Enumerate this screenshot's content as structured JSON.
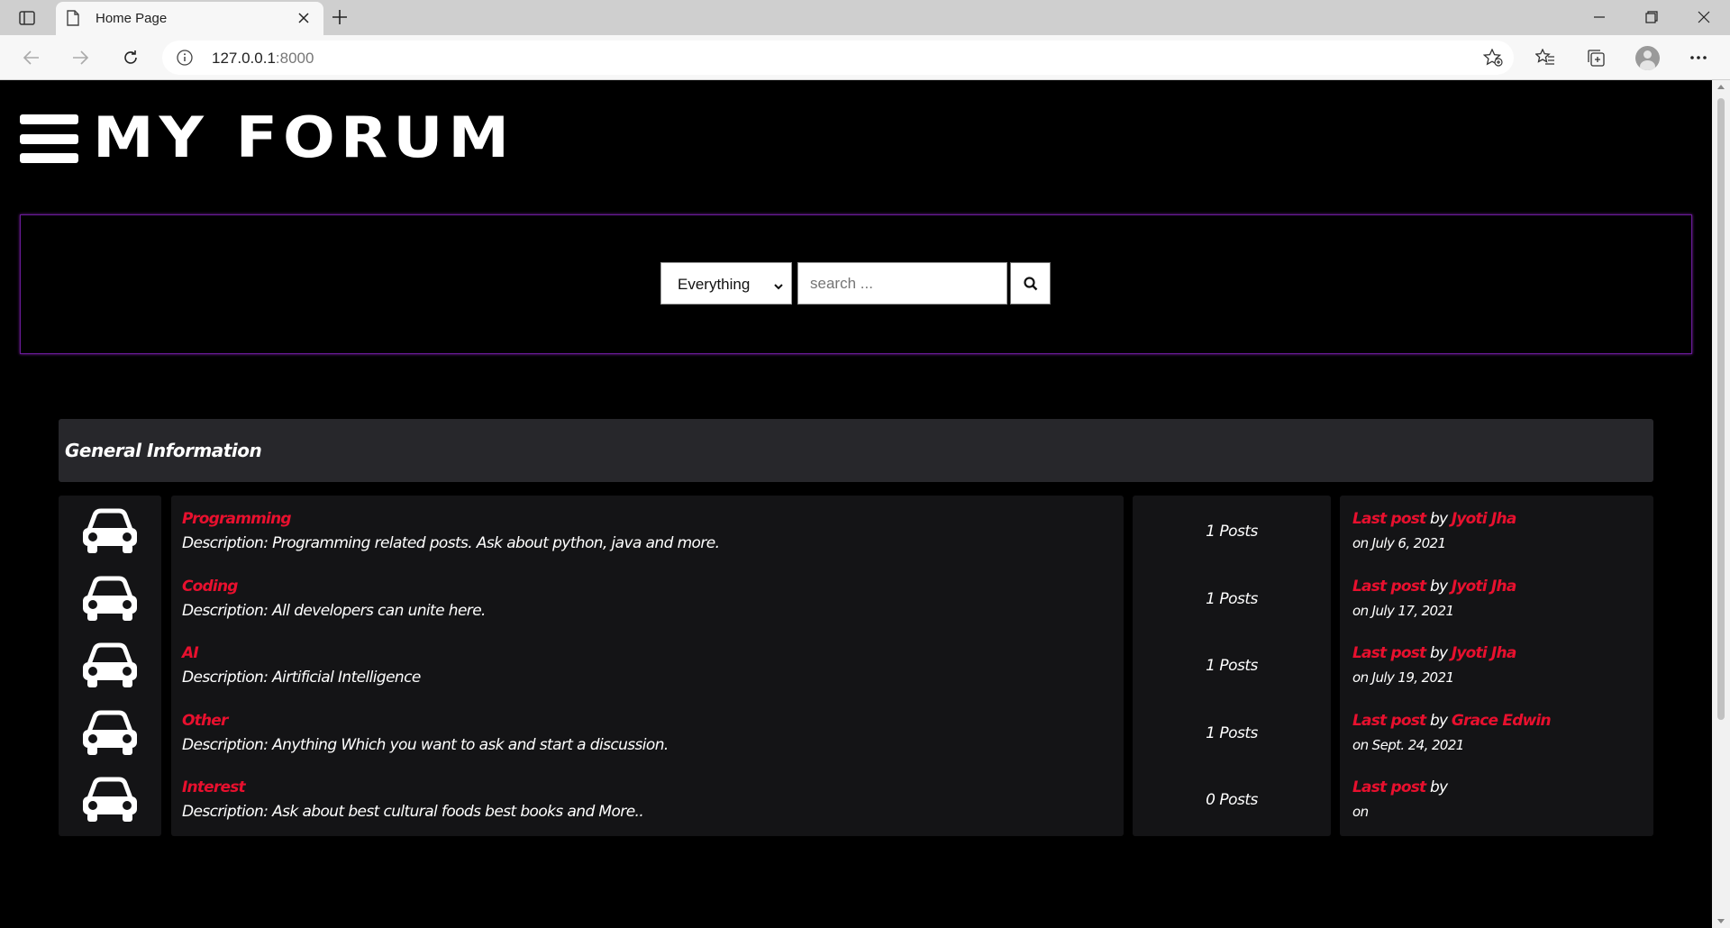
{
  "browser": {
    "tab_title": "Home Page",
    "url_host": "127.0.0.1",
    "url_port": ":8000"
  },
  "site": {
    "logo_text": "MY FORUM"
  },
  "search": {
    "scope_value": "Everything",
    "placeholder": "search ..."
  },
  "section": {
    "title": "General Information"
  },
  "labels": {
    "last_post": "Last post",
    "by": "by"
  },
  "forums": [
    {
      "name": "Programming",
      "description": "Description: Programming related posts. Ask about python, java and more.",
      "posts": "1 Posts",
      "author": "Jyoti Jha",
      "date_line": "on July 6, 2021",
      "icon": "car-icon"
    },
    {
      "name": "Coding",
      "description": "Description: All developers can unite here.",
      "posts": "1 Posts",
      "author": "Jyoti Jha",
      "date_line": "on July 17, 2021",
      "icon": "car-icon"
    },
    {
      "name": "AI",
      "description": "Description: Airtificial Intelligence",
      "posts": "1 Posts",
      "author": "Jyoti Jha",
      "date_line": "on July 19, 2021",
      "icon": "car-icon"
    },
    {
      "name": "Other",
      "description": "Description: Anything Which you want to ask and start a discussion.",
      "posts": "1 Posts",
      "author": "Grace Edwin",
      "date_line": "on Sept. 24, 2021",
      "icon": "car-icon"
    },
    {
      "name": "Interest",
      "description": "Description: Ask about best cultural foods best books and More..",
      "posts": "0 Posts",
      "author": "",
      "date_line": "on",
      "icon": "car-icon"
    }
  ],
  "colors": {
    "accent_red": "#e8102e",
    "panel_border": "#6a1b9a",
    "row_bg": "#141416",
    "header_bg": "#27272b"
  }
}
